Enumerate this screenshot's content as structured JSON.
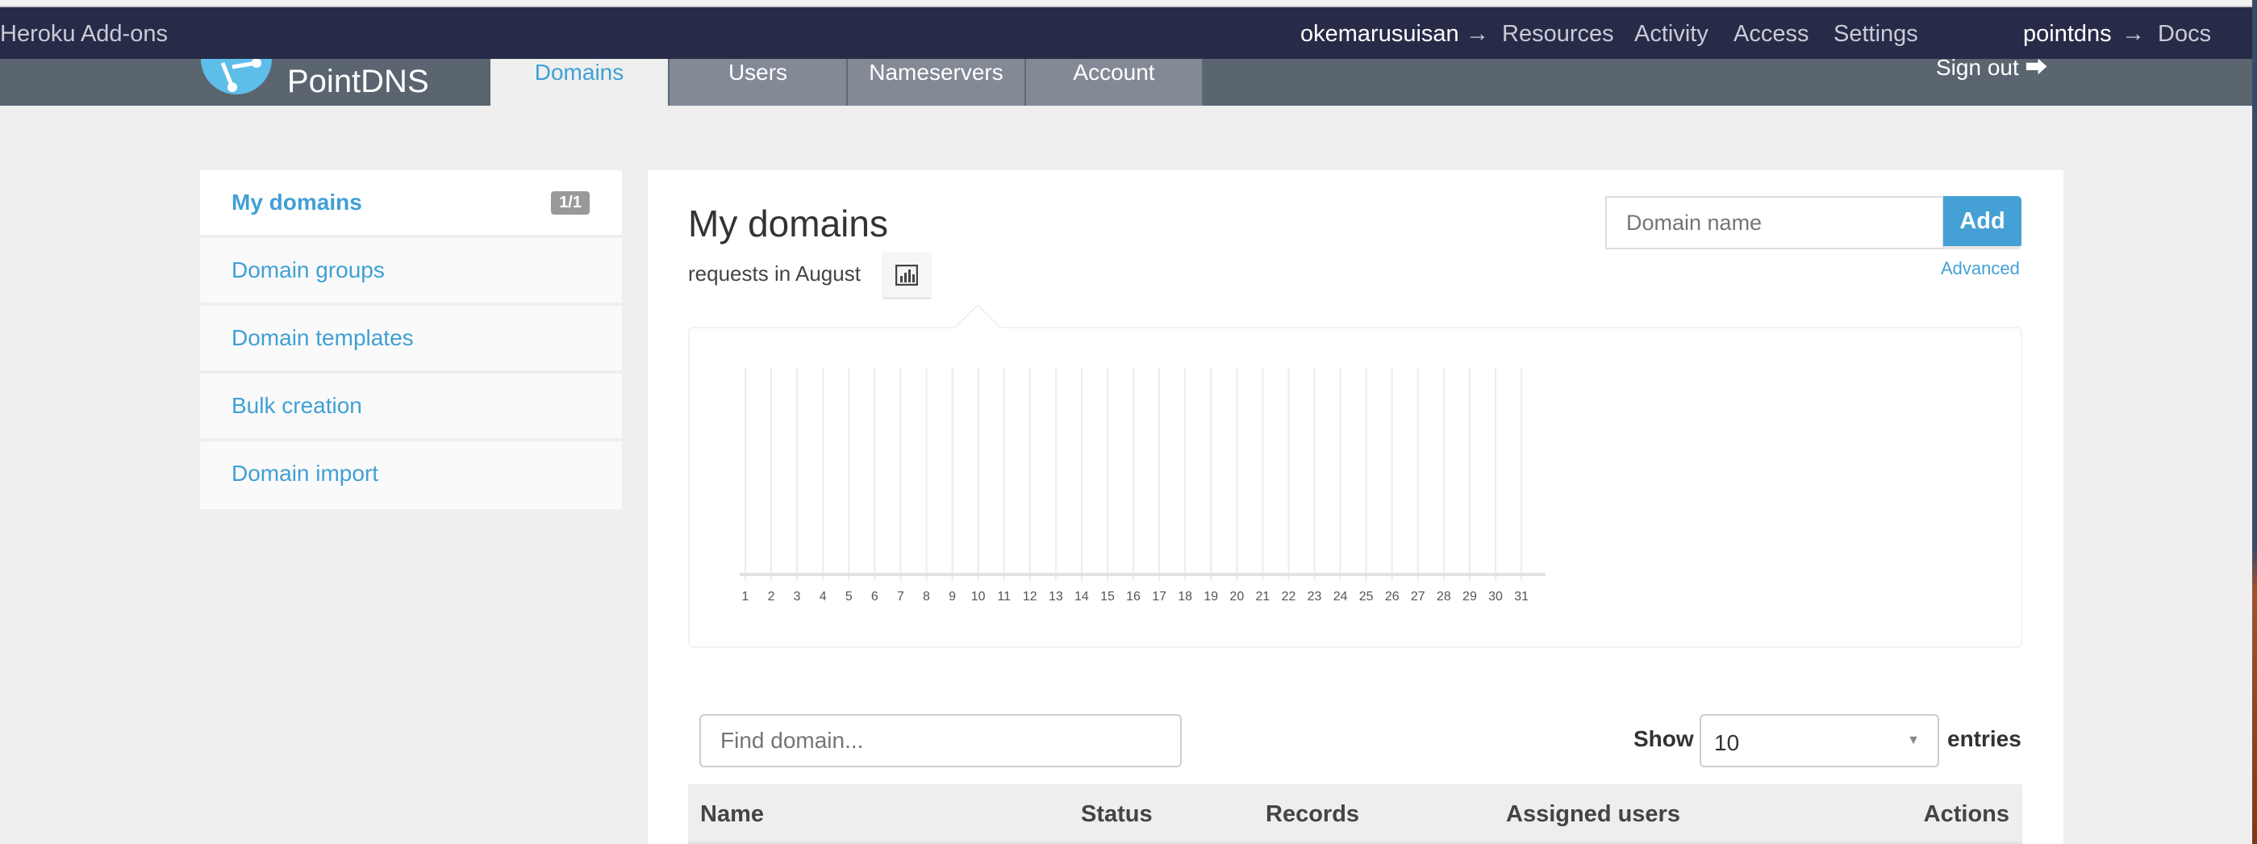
{
  "heroku": {
    "brand": "Heroku Add-ons",
    "app": "okemarusuisan",
    "arrow": "→",
    "links": [
      "Resources",
      "Activity",
      "Access",
      "Settings"
    ],
    "addon": "pointdns",
    "arrow2": "→",
    "docs": "Docs"
  },
  "app": {
    "logo_text": "PointDNS",
    "tabs": [
      {
        "label": "Domains",
        "active": true
      },
      {
        "label": "Users"
      },
      {
        "label": "Nameservers"
      },
      {
        "label": "Account"
      }
    ],
    "signout": "Sign out"
  },
  "sidebar": {
    "items": [
      {
        "label": "My domains",
        "badge": "1/1"
      },
      {
        "label": "Domain groups"
      },
      {
        "label": "Domain templates"
      },
      {
        "label": "Bulk creation"
      },
      {
        "label": "Domain import"
      }
    ]
  },
  "main": {
    "title": "My domains",
    "subtitle": "requests in August",
    "domain_placeholder": "Domain name",
    "add_label": "Add",
    "advanced_label": "Advanced",
    "find_placeholder": "Find domain...",
    "show_label": "Show",
    "page_size": "10",
    "entries_label": "entries",
    "columns": [
      "Name",
      "Status",
      "Records",
      "Assigned users",
      "Actions"
    ]
  },
  "colors": {
    "accent": "#45a1d5",
    "heroku_bar": "#272b48",
    "app_bar": "#5a6570"
  },
  "chart_data": {
    "type": "bar",
    "categories": [
      "1",
      "2",
      "3",
      "4",
      "5",
      "6",
      "7",
      "8",
      "9",
      "10",
      "11",
      "12",
      "13",
      "14",
      "15",
      "16",
      "17",
      "18",
      "19",
      "20",
      "21",
      "22",
      "23",
      "24",
      "25",
      "26",
      "27",
      "28",
      "29",
      "30",
      "31"
    ],
    "values": [
      0,
      0,
      0,
      0,
      0,
      0,
      0,
      0,
      0,
      0,
      0,
      0,
      0,
      0,
      0,
      0,
      0,
      0,
      0,
      0,
      0,
      0,
      0,
      0,
      0,
      0,
      0,
      0,
      0,
      0,
      0
    ],
    "grid": true
  }
}
